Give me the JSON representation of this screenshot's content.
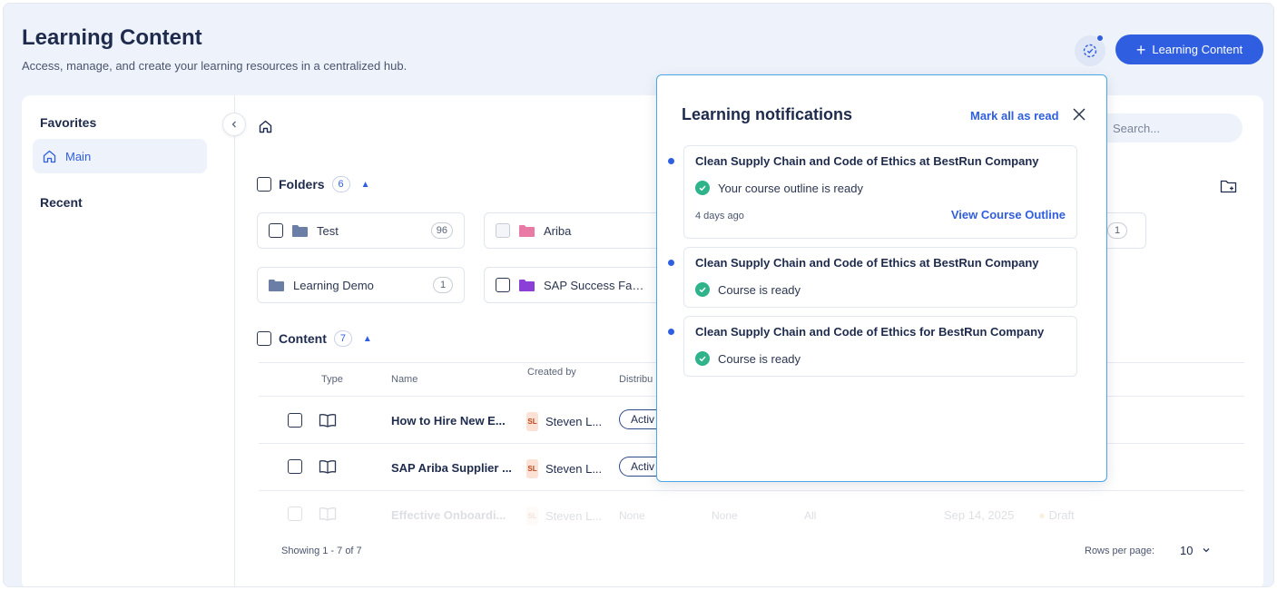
{
  "header": {
    "title": "Learning Content",
    "subtitle": "Access, manage, and create your learning resources in a centralized hub.",
    "primary_button": "Learning Content"
  },
  "sidebar": {
    "favorites_label": "Favorites",
    "items": [
      {
        "label": "Main",
        "icon": "home-icon"
      }
    ],
    "recent_label": "Recent"
  },
  "search": {
    "placeholder": "Search..."
  },
  "folders": {
    "label": "Folders",
    "count": "6",
    "items": [
      {
        "name": "Test",
        "count": "96",
        "color": "#6a7ea6"
      },
      {
        "name": "Ariba",
        "count": "",
        "color": "#e97aa6"
      },
      {
        "name": "",
        "count": "1",
        "color": "#6a7ea6"
      },
      {
        "name": "Learning Demo",
        "count": "1",
        "color": "#6a7ea6"
      },
      {
        "name": "SAP Success Fact...",
        "count": "",
        "color": "#8a3fd6"
      }
    ]
  },
  "content": {
    "label": "Content",
    "count": "7",
    "columns": [
      "Type",
      "Name",
      "Created by",
      "Distribu"
    ],
    "rows": [
      {
        "name": "How to Hire New E...",
        "initials": "SL",
        "creator": "Steven L...",
        "status": "Activ"
      },
      {
        "name": "SAP Ariba Supplier ...",
        "initials": "SL",
        "creator": "Steven L...",
        "status": "Activ"
      },
      {
        "name": "Effective Onboardi...",
        "initials": "SL",
        "creator": "Steven L...",
        "col4": "None",
        "col5": "None",
        "col6": "All",
        "date": "Sep 14, 2025",
        "state": "Draft"
      }
    ]
  },
  "footer": {
    "showing": "Showing 1 - 7 of 7",
    "rows_per_page_label": "Rows per page:",
    "rows_per_page_value": "10"
  },
  "notifications": {
    "title": "Learning notifications",
    "mark_all": "Mark all as read",
    "items": [
      {
        "title": "Clean Supply Chain and Code of Ethics at BestRun Company",
        "status": "Your course outline is ready",
        "time": "4 days ago",
        "link": "View Course Outline"
      },
      {
        "title": "Clean Supply Chain and Code of Ethics at BestRun Company",
        "status": "Course is ready"
      },
      {
        "title": "Clean Supply Chain and Code of Ethics for BestRun Company",
        "status": "Course is ready"
      }
    ]
  },
  "colors": {
    "accent": "#2f5ee0",
    "success": "#2fb38a",
    "panel_border": "#4aa6e6"
  }
}
